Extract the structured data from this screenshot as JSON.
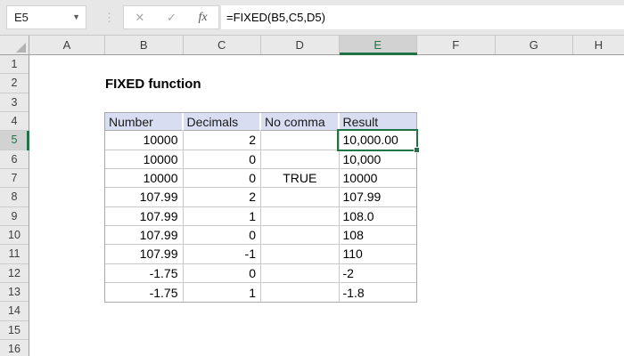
{
  "formula_bar": {
    "name_box_value": "E5",
    "cancel_icon": "✕",
    "enter_icon": "✓",
    "fx_icon": "fx",
    "dots_icon": "⋮",
    "dropdown_icon": "▼",
    "formula": "=FIXED(B5,C5,D5)"
  },
  "grid": {
    "column_headers": [
      "A",
      "B",
      "C",
      "D",
      "E",
      "F",
      "G",
      "H"
    ],
    "row_headers": [
      "1",
      "2",
      "3",
      "4",
      "5",
      "6",
      "7",
      "8",
      "9",
      "10",
      "11",
      "12",
      "13",
      "14",
      "15",
      "16"
    ],
    "selected_column": "E",
    "selected_row": "5",
    "selected_cell": "E5"
  },
  "sheet": {
    "title": "FIXED function",
    "table": {
      "headers": [
        "Number",
        "Decimals",
        "No comma",
        "Result"
      ],
      "rows": [
        [
          "10000",
          "2",
          "",
          "10,000.00"
        ],
        [
          "10000",
          "0",
          "",
          "10,000"
        ],
        [
          "10000",
          "0",
          "TRUE",
          "10000"
        ],
        [
          "107.99",
          "2",
          "",
          "107.99"
        ],
        [
          "107.99",
          "1",
          "",
          "108.0"
        ],
        [
          "107.99",
          "0",
          "",
          "108"
        ],
        [
          "107.99",
          "-1",
          "",
          "110"
        ],
        [
          "-1.75",
          "0",
          "",
          "-2"
        ],
        [
          "-1.75",
          "1",
          "",
          "-1.8"
        ]
      ]
    }
  },
  "colors": {
    "accent_green": "#217346",
    "toolbar_bg": "#e7e7e7",
    "band_bg": "#e9e9e9",
    "selected_header_bg": "#d2d2d2",
    "table_header_fill": "#d9ddf2"
  }
}
